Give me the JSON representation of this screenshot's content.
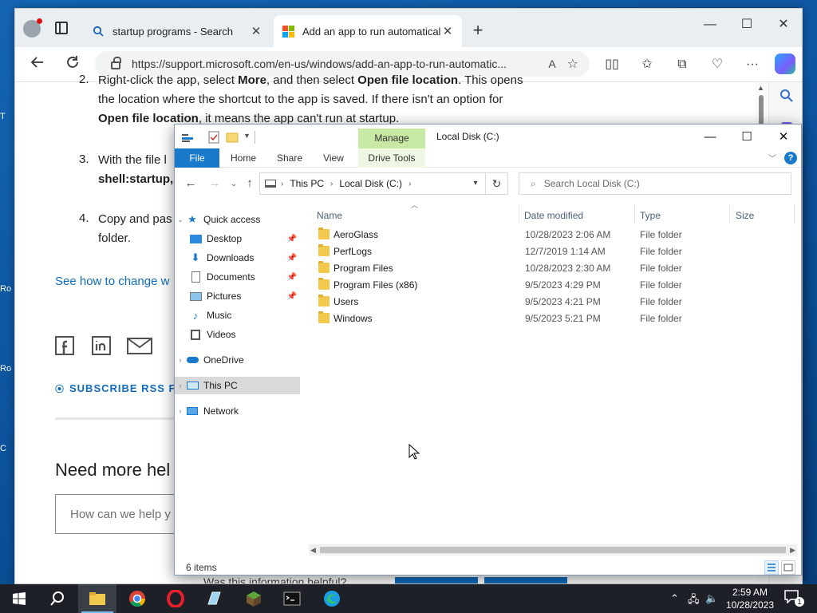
{
  "browser": {
    "tabs": [
      {
        "title": "startup programs - Search",
        "active": false
      },
      {
        "title": "Add an app to run automatically",
        "active": true
      }
    ],
    "url": "https://support.microsoft.com/en-us/windows/add-an-app-to-run-automatic...",
    "read_aloud": "A"
  },
  "article": {
    "step2_num": "2.",
    "step2_line1_a": "Right-click the app, select ",
    "step2_line1_b": "More",
    "step2_line1_c": ", and then select ",
    "step2_line1_d": "Open file location",
    "step2_line1_e": ". This opens",
    "step2_line2": "the location where the shortcut to the app is saved. If there isn't an option for",
    "step2_line3_a": "Open file location",
    "step2_line3_b": ", it means the app can't run at startup.",
    "step3_num": "3.",
    "step3_line1": "With the file l",
    "step3_line2": "shell:startup,",
    "step4_num": "4.",
    "step4_line1": "Copy and pas",
    "step4_line2": "folder.",
    "see_how": "See how to change w",
    "subscribe": "SUBSCRIBE RSS FEE",
    "need_more": "Need more hel",
    "help_placeholder": "How can we help y",
    "footer_peek": "Was this information helpful?"
  },
  "explorer": {
    "title": "Local Disk (C:)",
    "manage": "Manage",
    "ribbon_tabs": [
      "File",
      "Home",
      "Share",
      "View",
      "Drive Tools"
    ],
    "breadcrumb": [
      "This PC",
      "Local Disk (C:)"
    ],
    "search_placeholder": "Search Local Disk (C:)",
    "nav": {
      "quick_access": "Quick access",
      "desktop": "Desktop",
      "downloads": "Downloads",
      "documents": "Documents",
      "pictures": "Pictures",
      "music": "Music",
      "videos": "Videos",
      "onedrive": "OneDrive",
      "this_pc": "This PC",
      "network": "Network"
    },
    "columns": {
      "name": "Name",
      "date": "Date modified",
      "type": "Type",
      "size": "Size"
    },
    "files": [
      {
        "name": "AeroGlass",
        "date": "10/28/2023 2:06 AM",
        "type": "File folder"
      },
      {
        "name": "PerfLogs",
        "date": "12/7/2019 1:14 AM",
        "type": "File folder"
      },
      {
        "name": "Program Files",
        "date": "10/28/2023 2:30 AM",
        "type": "File folder"
      },
      {
        "name": "Program Files (x86)",
        "date": "9/5/2023 4:29 PM",
        "type": "File folder"
      },
      {
        "name": "Users",
        "date": "9/5/2023 4:21 PM",
        "type": "File folder"
      },
      {
        "name": "Windows",
        "date": "9/5/2023 5:21 PM",
        "type": "File folder"
      }
    ],
    "status": "6 items"
  },
  "taskbar": {
    "time": "2:59 AM",
    "date": "10/28/2023",
    "notification_count": "1"
  },
  "colors": {
    "accent": "#1979ca",
    "manage_tab": "#c7e9a3",
    "folder": "#f2c94c",
    "link": "#0f6cbd"
  }
}
